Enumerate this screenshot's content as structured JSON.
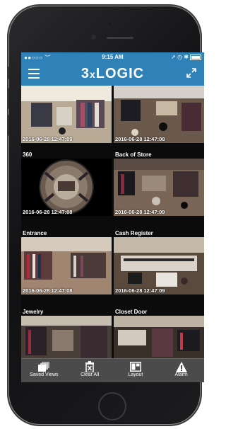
{
  "status": {
    "carrier": "●●○○○",
    "wifi": "wifi-icon",
    "time": "9:15 AM",
    "right_icons": "location-icon alarm-icon bluetooth-icon battery-icon"
  },
  "navbar": {
    "brand_prefix": "3",
    "brand_x": "x",
    "brand_suffix": "LOGIC"
  },
  "cameras": [
    {
      "title": "",
      "timestamp": "2016-06-28 12:47:09"
    },
    {
      "title": "",
      "timestamp": "2016-06-28 12:47:08"
    },
    {
      "title": "360",
      "timestamp": "2016-06-28 12:47:08"
    },
    {
      "title": "Back of Store",
      "timestamp": "2016-06-28 12:47:09"
    },
    {
      "title": "Entrance",
      "timestamp": "2016-06-28 12:47:08"
    },
    {
      "title": "Cash Register",
      "timestamp": "2016-06-28 12:47:09"
    },
    {
      "title": "Jewelry",
      "timestamp": ""
    },
    {
      "title": "Closet Door",
      "timestamp": ""
    }
  ],
  "toolbar": {
    "saved_views": "Saved Views",
    "clear_all": "Clear All",
    "layout": "Layout",
    "alarm": "Alarm"
  },
  "colors": {
    "header": "#2f82b8",
    "toolbar": "#4b4b4b",
    "background": "#0b0b0b"
  }
}
